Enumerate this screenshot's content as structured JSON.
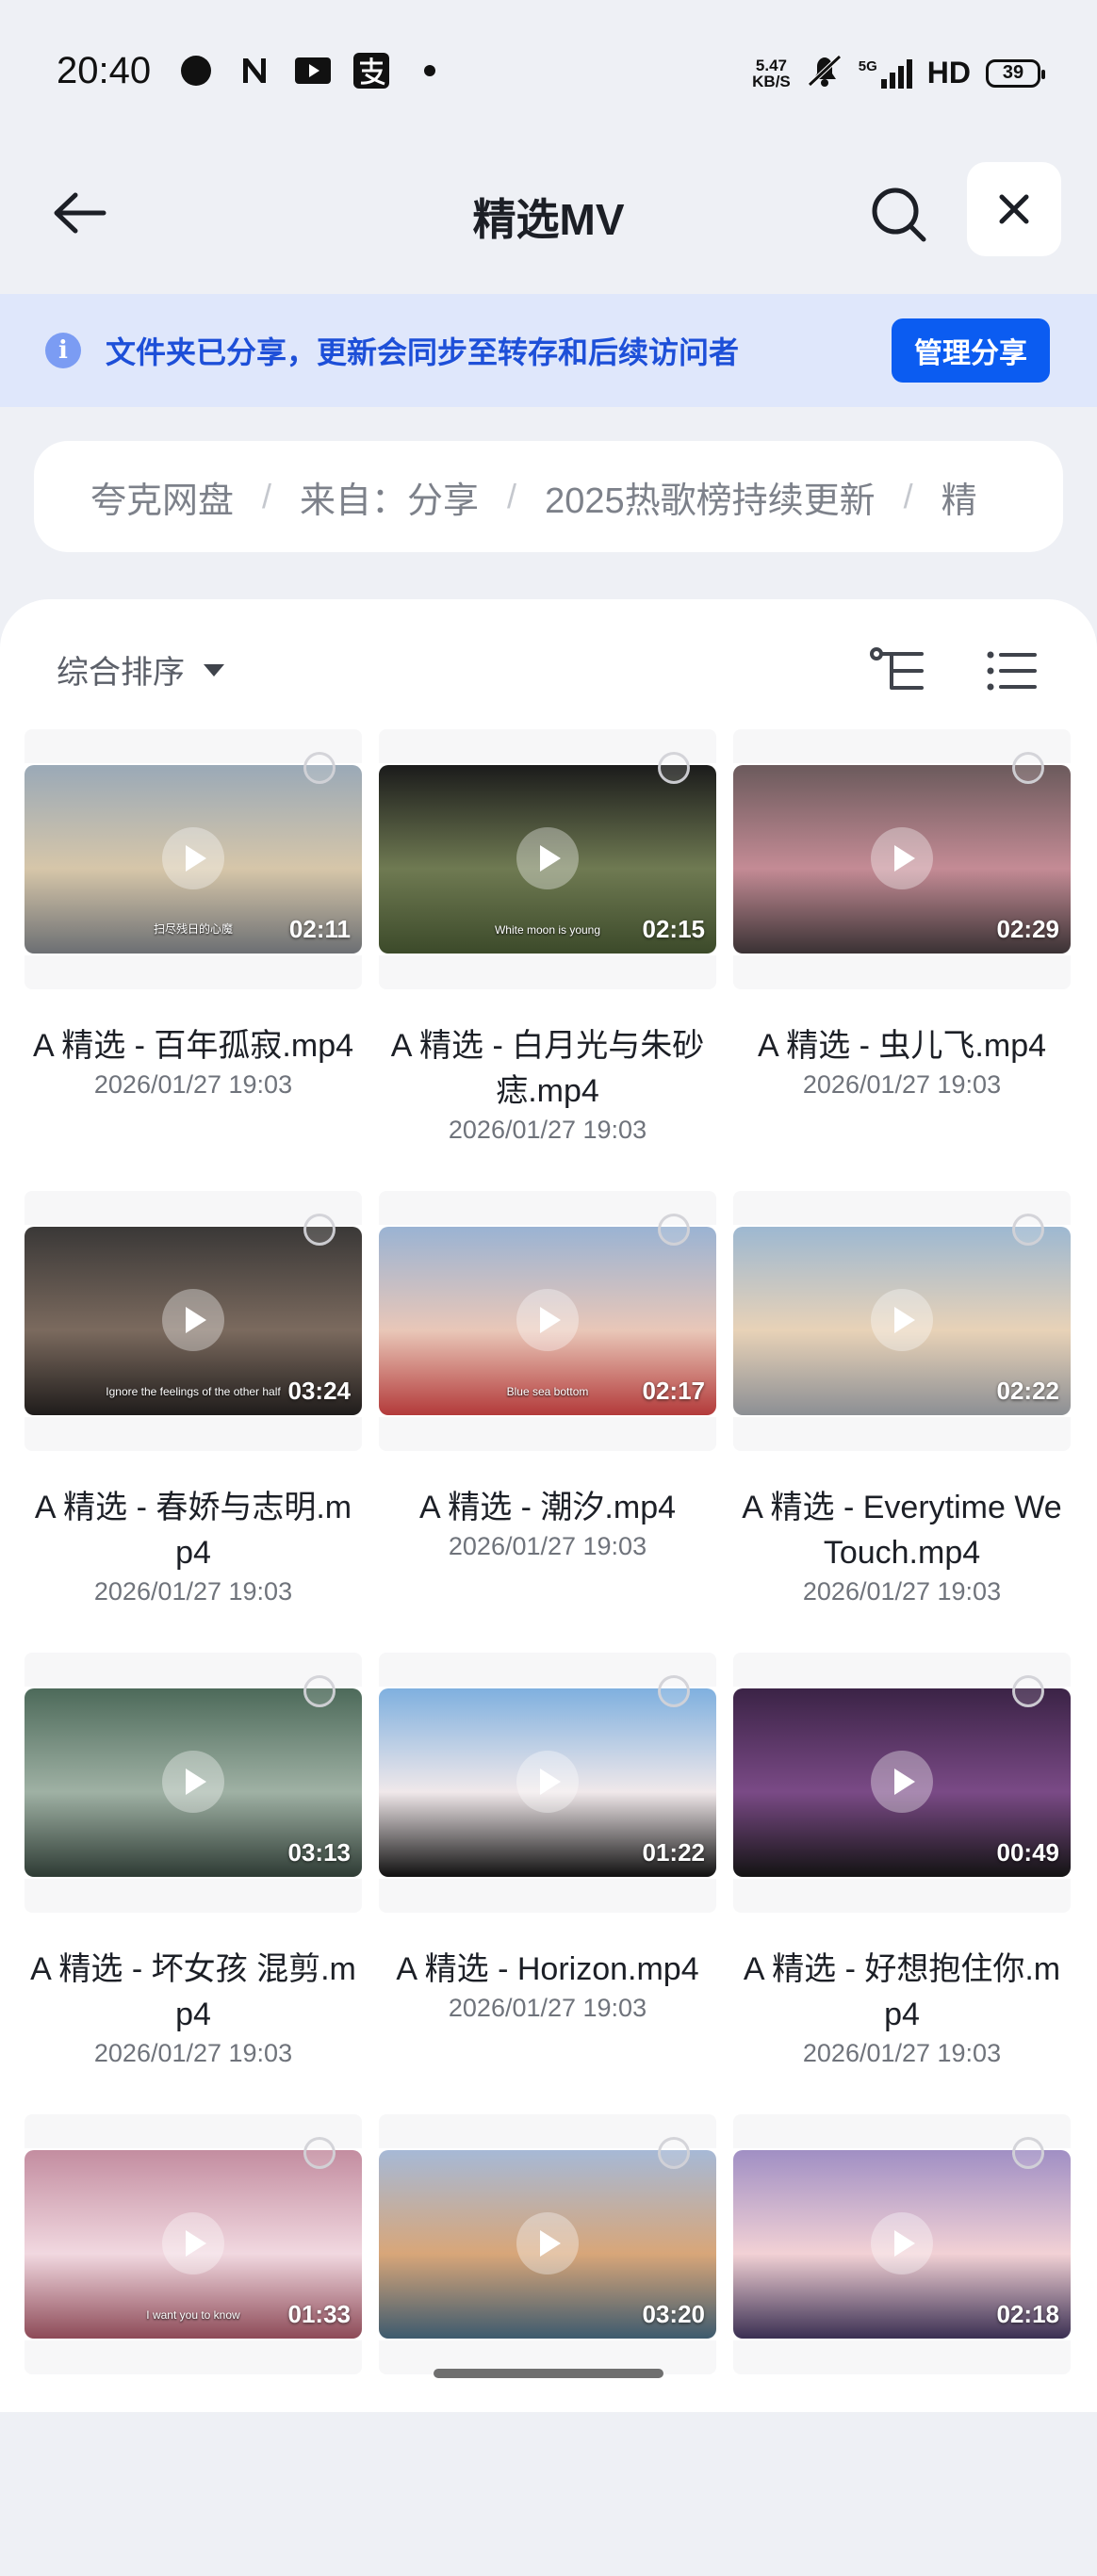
{
  "status_bar": {
    "time": "20:40",
    "left_icons": [
      "circle-app-icon",
      "n-app-icon",
      "youtube-icon",
      "alipay-icon",
      "dot-icon"
    ],
    "net_speed_value": "5.47",
    "net_speed_unit": "KB/S",
    "signal_label": "5G",
    "hd_label": "HD",
    "battery": "39"
  },
  "header": {
    "title": "精选MV"
  },
  "share_banner": {
    "text": "文件夹已分享，更新会同步至转存和后续访问者",
    "button": "管理分享",
    "accent": "#0b5cf1"
  },
  "breadcrumb": {
    "items": [
      "夸克网盘",
      "来自：分享",
      "2025热歌榜持续更新",
      "精"
    ]
  },
  "toolbar": {
    "sort_label": "综合排序"
  },
  "files": [
    {
      "name": "A 精选 - 百年孤寂.mp4",
      "date": "2026/01/27 19:03",
      "duration": "02:11",
      "caption": "扫尽残日的心魔",
      "palette": [
        "#9aa9b7",
        "#d6c6a9",
        "#6c6f73"
      ]
    },
    {
      "name": "A 精选 - 白月光与朱砂痣.mp4",
      "date": "2026/01/27 19:03",
      "duration": "02:15",
      "caption": "White moon is young",
      "palette": [
        "#1b1b1b",
        "#6f7a52",
        "#3c4a2a"
      ]
    },
    {
      "name": "A 精选 - 虫儿飞.mp4",
      "date": "2026/01/27 19:03",
      "duration": "02:29",
      "caption": "",
      "palette": [
        "#6b5a5c",
        "#c48b95",
        "#3a3234"
      ]
    },
    {
      "name": "A 精选 - 春娇与志明.mp4",
      "date": "2026/01/27 19:03",
      "duration": "03:24",
      "caption": "Ignore the feelings of the other half",
      "palette": [
        "#3a3837",
        "#7b6a5e",
        "#1f1c1b"
      ]
    },
    {
      "name": "A 精选 - 潮汐.mp4",
      "date": "2026/01/27 19:03",
      "duration": "02:17",
      "caption": "Blue sea bottom",
      "palette": [
        "#9ab3d3",
        "#e9c7b8",
        "#b33a3a"
      ]
    },
    {
      "name": "A 精选 - Everytime We Touch.mp4",
      "date": "2026/01/27 19:03",
      "duration": "02:22",
      "caption": "",
      "palette": [
        "#9db8d1",
        "#e8d2b7",
        "#8c8f94"
      ]
    },
    {
      "name": "A 精选 - 坏女孩 混剪.mp4",
      "date": "2026/01/27 19:03",
      "duration": "03:13",
      "caption": "",
      "palette": [
        "#4d6a5a",
        "#9fb1a4",
        "#2e3b34"
      ]
    },
    {
      "name": "A 精选 - Horizon.mp4",
      "date": "2026/01/27 19:03",
      "duration": "01:22",
      "caption": "",
      "palette": [
        "#7fb0df",
        "#f0e8ea",
        "#101010"
      ]
    },
    {
      "name": "A 精选 - 好想抱住你.mp4",
      "date": "2026/01/27 19:03",
      "duration": "00:49",
      "caption": "",
      "palette": [
        "#3b2346",
        "#7a4a86",
        "#131313"
      ]
    },
    {
      "name": "",
      "date": "",
      "duration": "01:33",
      "caption": "I want you to know",
      "palette": [
        "#c38da0",
        "#f1d8e0",
        "#8d4a57"
      ]
    },
    {
      "name": "",
      "date": "",
      "duration": "03:20",
      "caption": "",
      "palette": [
        "#a6b9d6",
        "#d8a679",
        "#3d5a6e"
      ]
    },
    {
      "name": "",
      "date": "",
      "duration": "02:18",
      "caption": "",
      "palette": [
        "#a08fc4",
        "#f2d1d5",
        "#3a2f52"
      ]
    }
  ]
}
